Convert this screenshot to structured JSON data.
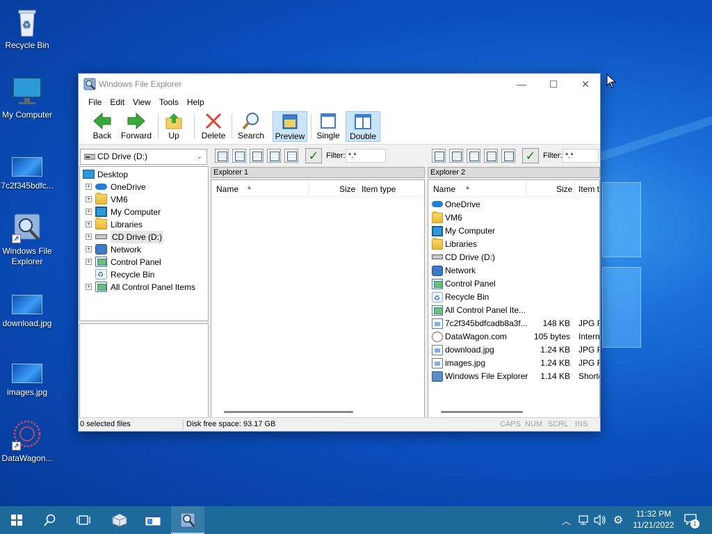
{
  "desktop": {
    "icons": [
      {
        "label": "Recycle Bin",
        "icon": "recycle-bin-icon"
      },
      {
        "label": "My Computer",
        "icon": "computer-icon"
      },
      {
        "label": "7c2f345bdfc...",
        "icon": "image-file-icon"
      },
      {
        "label": "Windows File Explorer",
        "icon": "file-explorer-shortcut-icon"
      },
      {
        "label": "download.jpg",
        "icon": "image-file-icon"
      },
      {
        "label": "images.jpg",
        "icon": "image-file-icon"
      },
      {
        "label": "DataWagon...",
        "icon": "datawagon-shortcut-icon"
      }
    ]
  },
  "window": {
    "title": "Windows File Explorer",
    "controls": {
      "minimize": "—",
      "maximize": "☐",
      "close": "✕"
    },
    "menu": [
      "File",
      "Edit",
      "View",
      "Tools",
      "Help"
    ],
    "toolbar": {
      "back": "Back",
      "forward": "Forward",
      "up": "Up",
      "delete": "Delete",
      "search": "Search",
      "preview": "Preview",
      "single": "Single",
      "double": "Double"
    },
    "drive_select": "CD Drive (D:)",
    "tree": {
      "root": "Desktop",
      "items": [
        "OneDrive",
        "VM6",
        "My Computer",
        "Libraries",
        "CD Drive (D:)",
        "Network",
        "Control Panel",
        "Recycle Bin",
        "All Control Panel Items"
      ]
    },
    "pane1": {
      "title": "Explorer 1",
      "filter_label": "Filter:",
      "filter_value": "*.*",
      "columns": {
        "name": "Name",
        "size": "Size",
        "type": "Item type"
      }
    },
    "pane2": {
      "title": "Explorer 2",
      "filter_label": "Filter:",
      "filter_value": "*.*",
      "columns": {
        "name": "Name",
        "size": "Size",
        "type": "Item t"
      },
      "rows": [
        {
          "name": "OneDrive",
          "size": "",
          "type": "",
          "icon": "onedrive-icon"
        },
        {
          "name": "VM6",
          "size": "",
          "type": "",
          "icon": "folder-icon"
        },
        {
          "name": "My Computer",
          "size": "",
          "type": "",
          "icon": "computer-icon"
        },
        {
          "name": "Libraries",
          "size": "",
          "type": "",
          "icon": "folder-icon"
        },
        {
          "name": "CD Drive (D:)",
          "size": "",
          "type": "",
          "icon": "drive-icon"
        },
        {
          "name": "Network",
          "size": "",
          "type": "",
          "icon": "network-icon"
        },
        {
          "name": "Control Panel",
          "size": "",
          "type": "",
          "icon": "control-panel-icon"
        },
        {
          "name": "Recycle Bin",
          "size": "",
          "type": "",
          "icon": "recycle-bin-icon"
        },
        {
          "name": "All Control Panel Ite...",
          "size": "",
          "type": "",
          "icon": "control-panel-icon"
        },
        {
          "name": "7c2f345bdfcadb8a3f...",
          "size": "148 KB",
          "type": "JPG Fi",
          "icon": "image-file-icon"
        },
        {
          "name": "DataWagon.com",
          "size": "105 bytes",
          "type": "Intern",
          "icon": "web-shortcut-icon"
        },
        {
          "name": "download.jpg",
          "size": "1.24 KB",
          "type": "JPG Fi",
          "icon": "image-file-icon"
        },
        {
          "name": "images.jpg",
          "size": "1.24 KB",
          "type": "JPG Fi",
          "icon": "image-file-icon"
        },
        {
          "name": "Windows File Explorer",
          "size": "1.14 KB",
          "type": "Shorte",
          "icon": "file-explorer-icon"
        }
      ]
    },
    "status": {
      "selected": "0 selected files",
      "free_space": "Disk free space: 93.17 GB",
      "caps": "CAPS",
      "num": "NUM",
      "scrl": "SCRL",
      "ins": "INS"
    }
  },
  "taskbar": {
    "time": "11:32 PM",
    "date": "11/21/2022",
    "notification_count": "1"
  }
}
